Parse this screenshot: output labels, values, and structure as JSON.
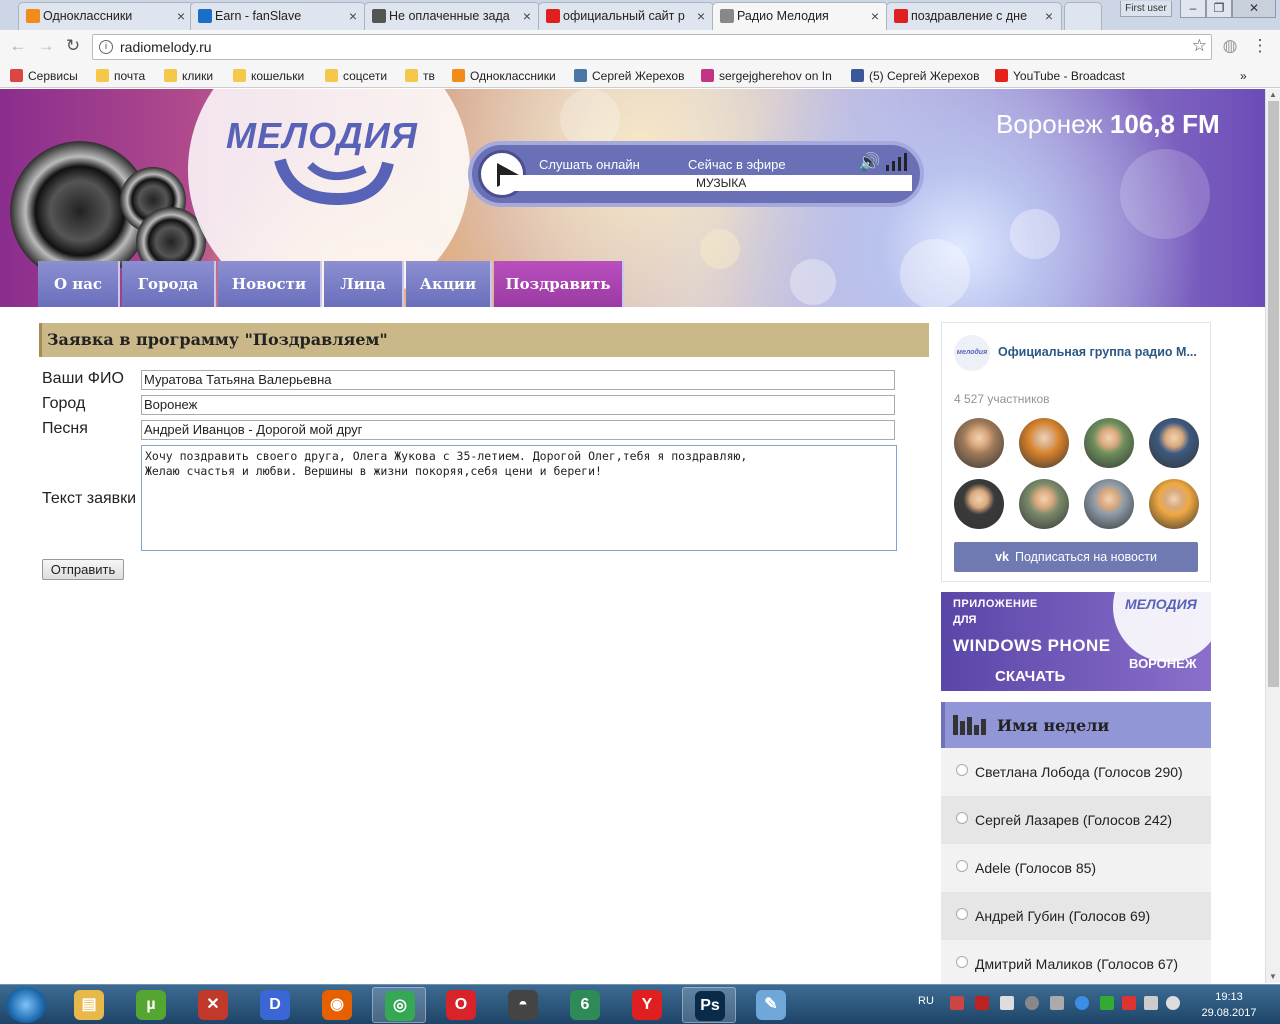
{
  "browser": {
    "tabs": [
      {
        "title": "Одноклассники",
        "icon": "odnoklassniki-icon",
        "color": "#f28b1a"
      },
      {
        "title": "Earn - fanSlave",
        "icon": "fanslave-icon",
        "color": "#1a6ec8"
      },
      {
        "title": "Не оплаченные зада",
        "icon": "envelope-icon",
        "color": "#555555"
      },
      {
        "title": "официальный сайт р",
        "icon": "yandex-icon",
        "color": "#e02020"
      },
      {
        "title": "Радио Мелодия",
        "icon": "page-icon",
        "color": "#888888"
      },
      {
        "title": "поздравление с дне",
        "icon": "yandex-icon",
        "color": "#e02020"
      }
    ],
    "active_tab": 4,
    "user_button": "First user",
    "url": "radiomelody.ru"
  },
  "bookmarks": [
    {
      "label": "Сервисы",
      "icon": "apps-grid-icon",
      "color": "#d44"
    },
    {
      "label": "почта",
      "icon": "folder-icon",
      "color": "#f5c84a"
    },
    {
      "label": "клики",
      "icon": "folder-icon",
      "color": "#f5c84a"
    },
    {
      "label": "кошельки",
      "icon": "folder-icon",
      "color": "#f5c84a"
    },
    {
      "label": "соцсети",
      "icon": "folder-icon",
      "color": "#f5c84a"
    },
    {
      "label": "тв",
      "icon": "folder-icon",
      "color": "#f5c84a"
    },
    {
      "label": "Одноклассники",
      "icon": "odnoklassniki-icon",
      "color": "#f28b1a"
    },
    {
      "label": "Сергей Жерехов",
      "icon": "vk-icon",
      "color": "#4a76a8"
    },
    {
      "label": "sergejgherehov on In",
      "icon": "instagram-icon",
      "color": "#c13584"
    },
    {
      "label": "(5) Сергей Жерехов",
      "icon": "facebook-icon",
      "color": "#3b5998"
    },
    {
      "label": "YouTube - Broadcast",
      "icon": "youtube-icon",
      "color": "#e62117"
    }
  ],
  "bookmarks_more": "»",
  "header": {
    "logo": "МЕЛОДИЯ",
    "city": "Воронеж",
    "frequency": "106,8 FM",
    "listen_label": "Слушать онлайн",
    "onair_label": "Сейчас в эфире",
    "now_playing": "МУЗЫКА"
  },
  "menu": [
    {
      "label": "О нас"
    },
    {
      "label": "Города"
    },
    {
      "label": "Новости"
    },
    {
      "label": "Лица"
    },
    {
      "label": "Акции"
    },
    {
      "label": "Поздравить"
    }
  ],
  "form": {
    "title": "Заявка в программу \"Поздравляем\"",
    "name_label": "Ваши ФИО",
    "name_value": "Муратова Татьяна Валерьевна",
    "city_label": "Город",
    "city_value": "Воронеж",
    "song_label": "Песня",
    "song_value": "Андрей Иванцов - Дорогой мой друг",
    "text_label": "Текст заявки",
    "text_value": "Хочу поздравить своего друга, Олега Жукова с 35-летием. Дорогой Олег,тебя я поздравляю,\nЖелаю счастья и любви. Вершины в жизни покоряя,себя цени и береги!",
    "submit_label": "Отправить"
  },
  "vk_widget": {
    "logo_text": "мелодия",
    "title": "Официальная группа радио М...",
    "members": "4 527 участников",
    "avatar_colors": [
      "#a07a5a",
      "#d9822b",
      "#6d8f5c",
      "#3d5a80",
      "#3a3a3a",
      "#7a8a6a",
      "#8d9aa8",
      "#f0a840"
    ],
    "subscribe_label": "Подписаться на новости"
  },
  "app_banner": {
    "line1": "ПРИЛОЖЕНИЕ",
    "line2": "ДЛЯ",
    "line3": "WINDOWS PHONE",
    "line4": "СКАЧАТЬ",
    "logo": "МЕЛОДИЯ",
    "city": "ВОРОНЕЖ"
  },
  "poll": {
    "title": "Имя недели",
    "items": [
      {
        "label": "Светлана Лобода (Голосов 290)"
      },
      {
        "label": "Сергей Лазарев (Голосов 242)"
      },
      {
        "label": "Adele (Голосов 85)"
      },
      {
        "label": "Андрей Губин (Голосов 69)"
      },
      {
        "label": "Дмитрий Маликов (Голосов 67)"
      }
    ]
  },
  "taskbar": {
    "apps": [
      {
        "icon": "explorer-icon",
        "color": "#e8b84a",
        "glyph": "▤",
        "active": false
      },
      {
        "icon": "utorrent-icon",
        "color": "#55a630",
        "glyph": "µ",
        "active": false
      },
      {
        "icon": "tool-icon",
        "color": "#c0392b",
        "glyph": "✕",
        "active": false
      },
      {
        "icon": "d-app-icon",
        "color": "#3a66d6",
        "glyph": "D",
        "active": false
      },
      {
        "icon": "firefox-icon",
        "color": "#e66000",
        "glyph": "◉",
        "active": false
      },
      {
        "icon": "chrome-icon",
        "color": "#34a853",
        "glyph": "◎",
        "active": true
      },
      {
        "icon": "opera-icon",
        "color": "#d8232a",
        "glyph": "O",
        "active": false
      },
      {
        "icon": "incognito-icon",
        "color": "#444444",
        "glyph": "◓",
        "active": false
      },
      {
        "icon": "lock-app-icon",
        "color": "#2e8b57",
        "glyph": "6",
        "active": false
      },
      {
        "icon": "yandex-browser-icon",
        "color": "#e02020",
        "glyph": "Y",
        "active": false
      },
      {
        "icon": "photoshop-icon",
        "color": "#0a2a4a",
        "glyph": "Ps",
        "active": true
      },
      {
        "icon": "notepad-icon",
        "color": "#6fa8d8",
        "glyph": "✎",
        "active": false
      }
    ],
    "lang": "RU",
    "time": "19:13",
    "date": "29.08.2017"
  }
}
